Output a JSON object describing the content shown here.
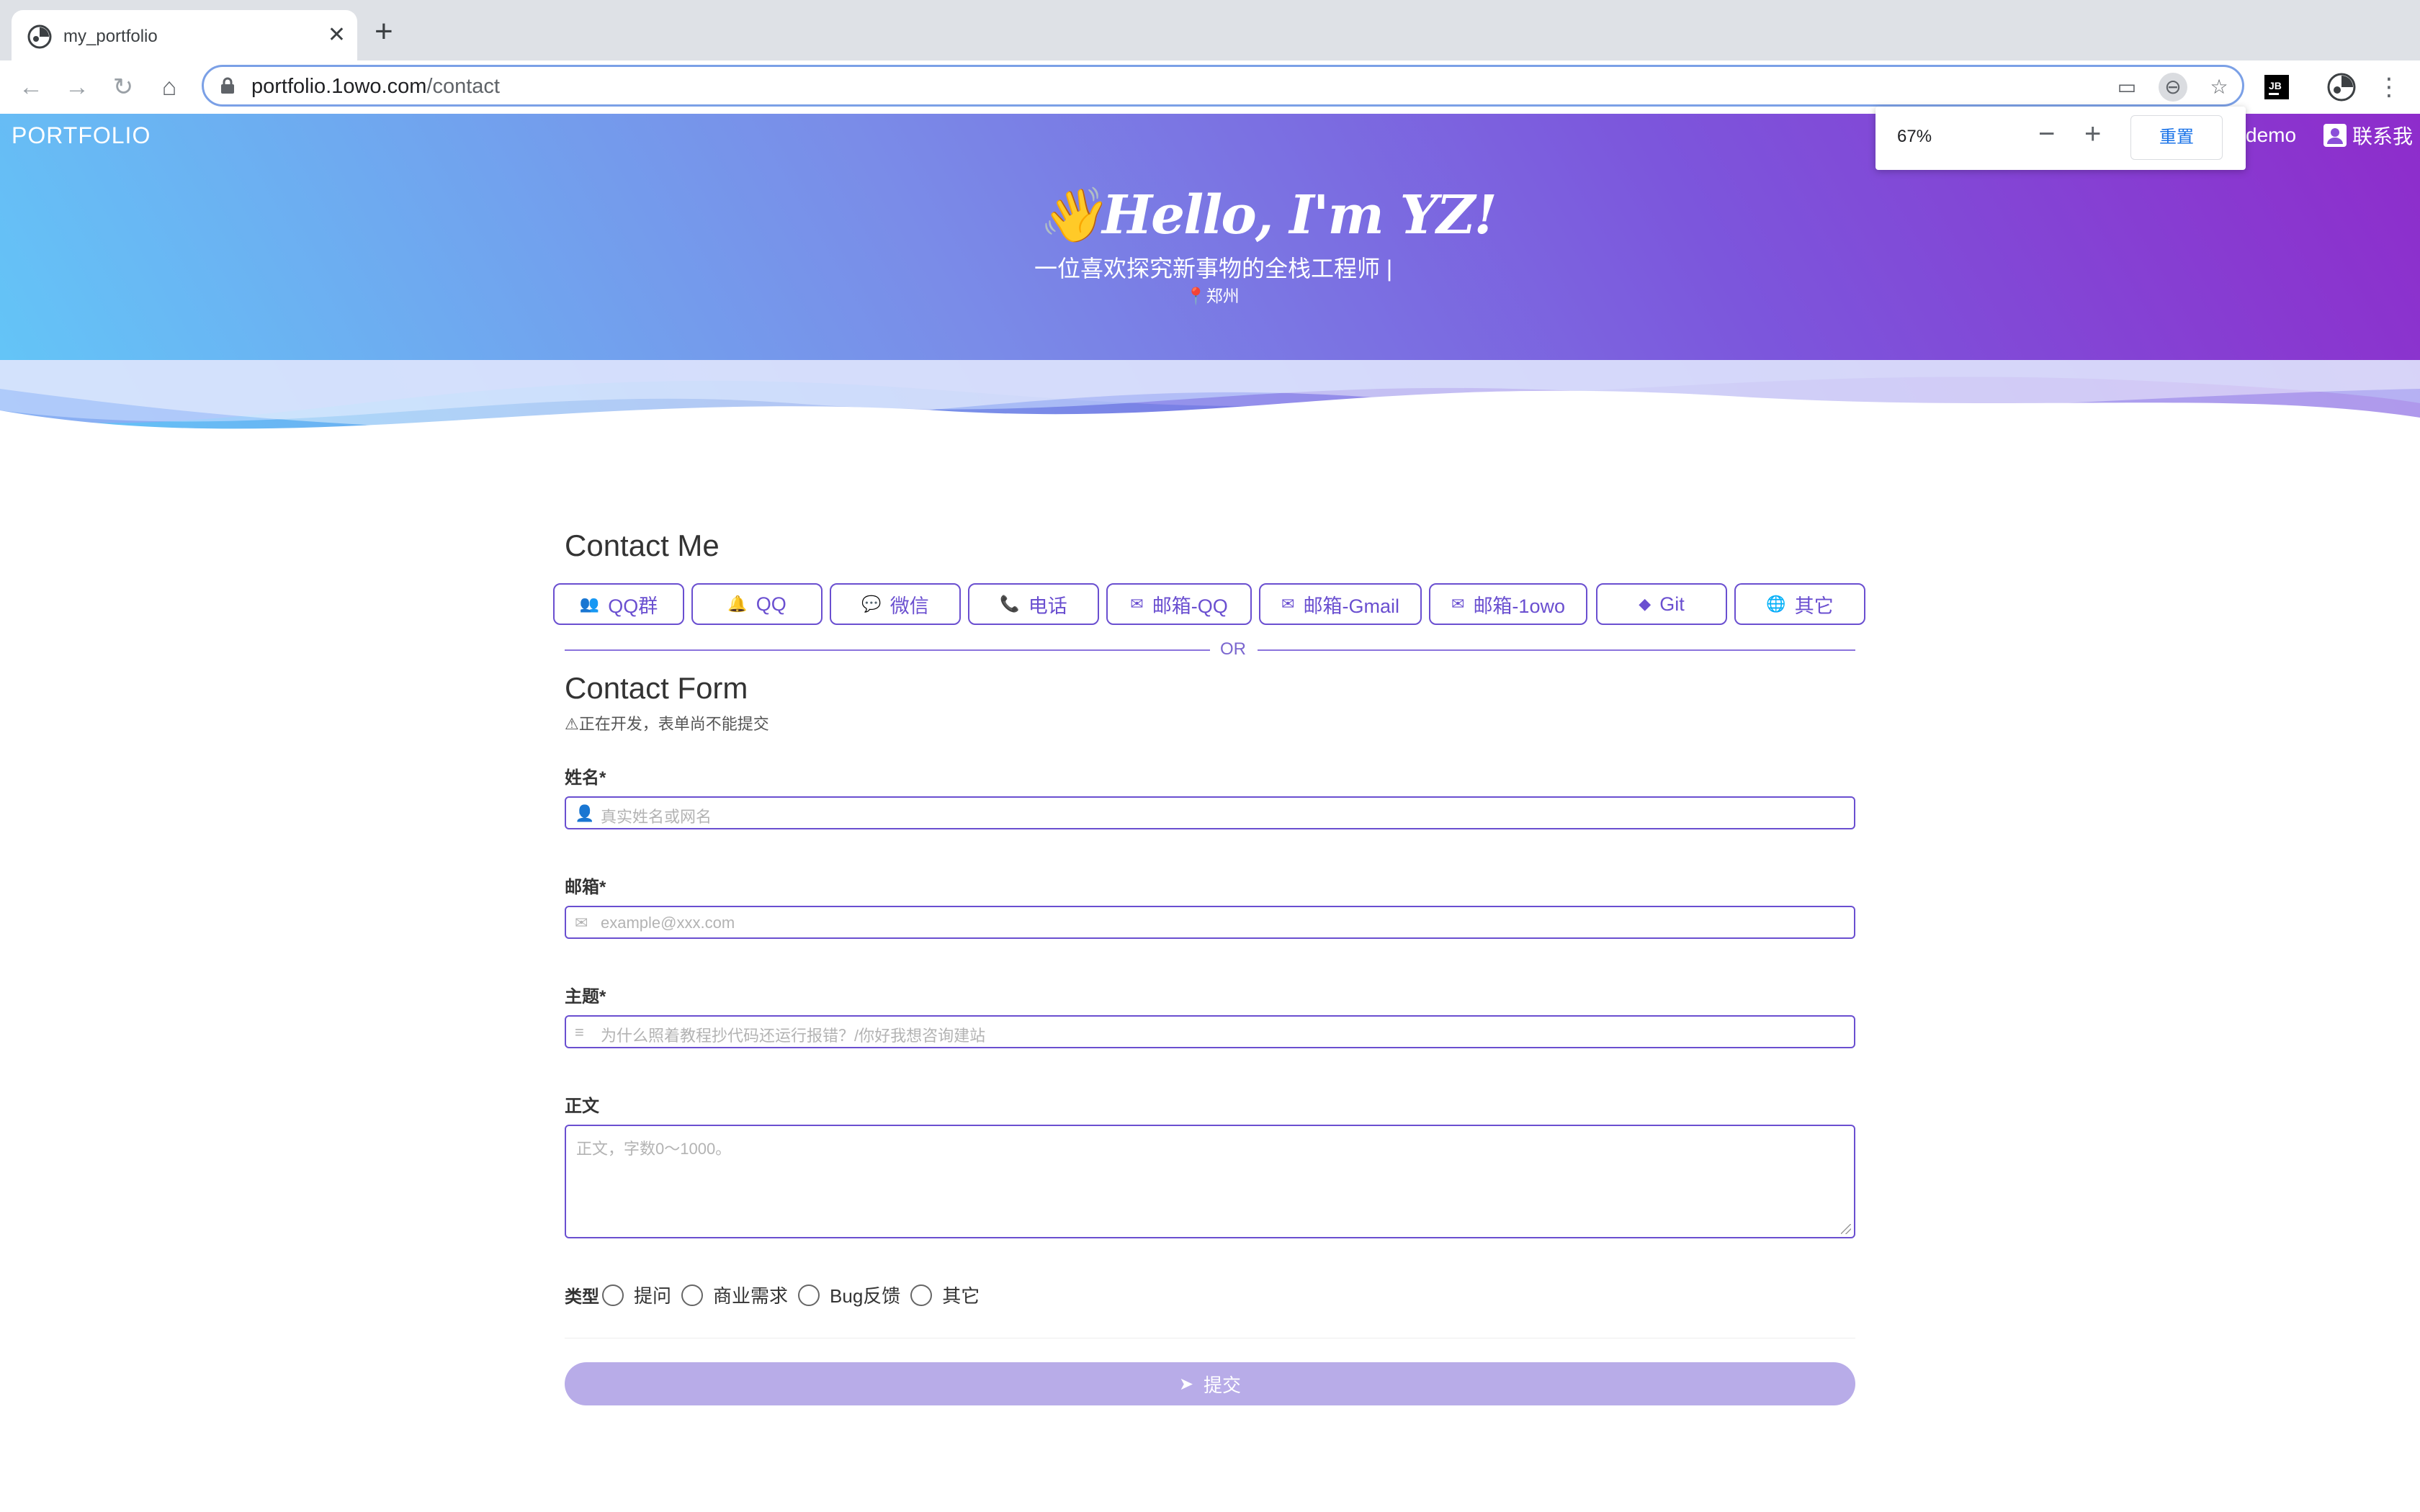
{
  "browser": {
    "tab_title": "my_portfolio",
    "url_host": "portfolio.1owo.com",
    "url_path": "/contact",
    "zoom": {
      "percent": "67%",
      "reset_label": "重置"
    },
    "icons": [
      "back-icon",
      "forward-icon",
      "reload-icon",
      "home-icon",
      "lock-icon",
      "cast-icon",
      "zoom-icon",
      "star-icon",
      "jetbrains-extension-icon",
      "profile-icon",
      "menu-icon"
    ]
  },
  "site": {
    "brand": "PORTFOLIO",
    "nav": {
      "demo": "demo",
      "contact": "联系我"
    },
    "hero": {
      "title": "👋Hello, I'm YZ!",
      "subtitle": "一位喜欢探究新事物的全栈工程师 |",
      "location": "郑州"
    },
    "colors": {
      "accent": "#6a4fd0",
      "submit_bg": "#b8ace8",
      "hero_start": "#62c8f8",
      "hero_end": "#8e2ccb"
    }
  },
  "contact": {
    "heading": "Contact Me",
    "channels": [
      {
        "label": "QQ群",
        "icon": "group-icon"
      },
      {
        "label": "QQ",
        "icon": "qq-icon"
      },
      {
        "label": "微信",
        "icon": "wechat-icon"
      },
      {
        "label": "电话",
        "icon": "phone-icon"
      },
      {
        "label": "邮箱-QQ",
        "icon": "mail-icon"
      },
      {
        "label": "邮箱-Gmail",
        "icon": "gmail-icon"
      },
      {
        "label": "邮箱-1owo",
        "icon": "mail-icon"
      },
      {
        "label": "Git",
        "icon": "git-icon"
      },
      {
        "label": "其它",
        "icon": "globe-icon"
      }
    ],
    "or": "OR"
  },
  "form": {
    "heading": "Contact Form",
    "warning": "⚠正在开发，表单尚不能提交",
    "name": {
      "label": "姓名*",
      "placeholder": "真实姓名或网名"
    },
    "email": {
      "label": "邮箱*",
      "placeholder": "example@xxx.com"
    },
    "subject": {
      "label": "主题*",
      "placeholder": "为什么照着教程抄代码还运行报错？/你好我想咨询建站"
    },
    "body": {
      "label": "正文",
      "placeholder": "正文，字数0～1000。"
    },
    "type": {
      "label": "类型",
      "options": [
        "提问",
        "商业需求",
        "Bug反馈",
        "其它"
      ]
    },
    "submit": "提交"
  }
}
